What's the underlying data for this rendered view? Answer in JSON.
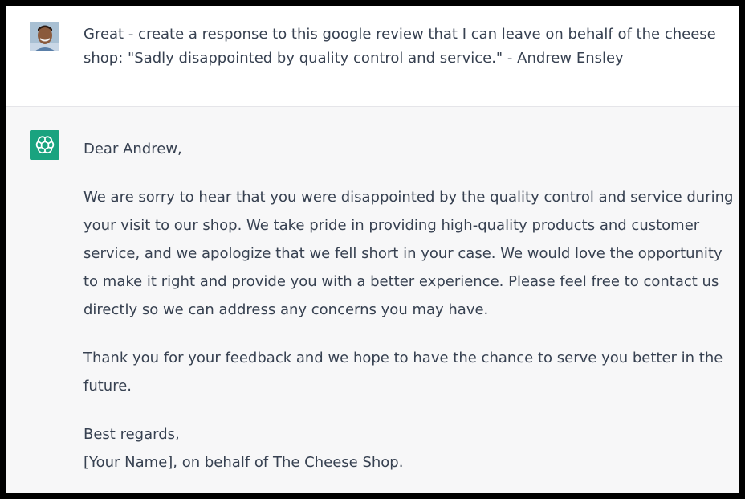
{
  "colors": {
    "frame_border": "#000000",
    "user_bg": "#ffffff",
    "assistant_bg": "#f7f7f8",
    "text": "#374151",
    "bot_avatar": "#19a37f"
  },
  "user_message": {
    "avatar_icon": "user-photo-avatar",
    "text": "Great - create a response to this google review that I can leave on behalf of the cheese shop: \"Sadly disappointed by quality control and service.\" - Andrew Ensley"
  },
  "assistant_message": {
    "avatar_icon": "openai-logo-icon",
    "greeting": "Dear Andrew,",
    "body": "We are sorry to hear that you were disappointed by the quality control and service during your visit to our shop. We take pride in providing high-quality products and customer service, and we apologize that we fell short in your case. We would love the opportunity to make it right and provide you with a better experience. Please feel free to contact us directly so we can address any concerns you may have.",
    "thanks": "Thank you for your feedback and we hope to have the chance to serve you better in the future.",
    "closing": "Best regards,",
    "signature": "[Your Name], on behalf of The Cheese Shop."
  }
}
